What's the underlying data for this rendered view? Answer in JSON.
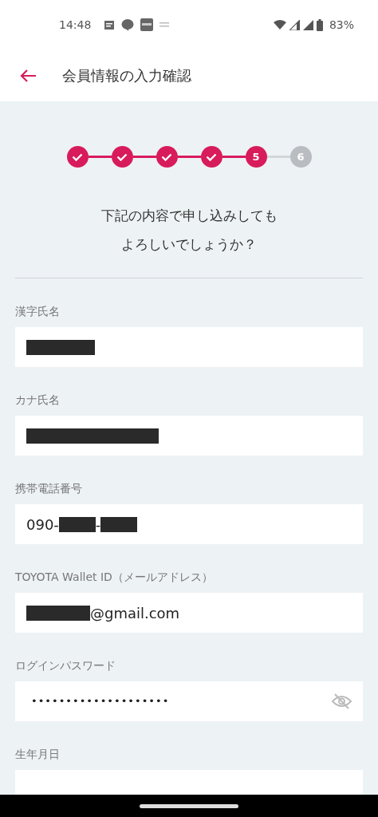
{
  "status_bar": {
    "time": "14:48",
    "battery": "83%"
  },
  "app_bar": {
    "title": "会員情報の入力確認"
  },
  "steps": [
    {
      "done": true,
      "selected": false
    },
    {
      "done": true,
      "selected": false
    },
    {
      "done": true,
      "selected": false
    },
    {
      "done": true,
      "selected": false
    },
    {
      "done": false,
      "selected": true,
      "label": "5"
    },
    {
      "done": false,
      "selected": false,
      "label": "6"
    }
  ],
  "question": [
    "下記の内容で申し込みしても",
    "よろしいでしょうか？"
  ],
  "fields": [
    {
      "label": "漢字氏名",
      "kind": "text",
      "value": [
        {
          "kind": "redacted"
        }
      ]
    },
    {
      "label": "カナ氏名",
      "kind": "text",
      "value": [
        {
          "kind": "redacted"
        }
      ]
    },
    {
      "label": "携帯電話番号",
      "kind": "text",
      "value": [
        {
          "kind": "text",
          "text": "090-"
        },
        {
          "kind": "redacted"
        },
        {
          "kind": "text",
          "text": "-"
        },
        {
          "kind": "redacted"
        }
      ]
    },
    {
      "label": "TOYOTA Wallet ID（メールアドレス）",
      "kind": "text",
      "value": [
        {
          "kind": "redacted"
        },
        {
          "kind": "text",
          "text": "@gmail.com"
        }
      ]
    },
    {
      "label": "ログインパスワード",
      "kind": "password",
      "value": [
        {
          "kind": "text",
          "text": "••••••••••••••••••••"
        }
      ]
    },
    {
      "label": "生年月日",
      "kind": "text"
    }
  ]
}
